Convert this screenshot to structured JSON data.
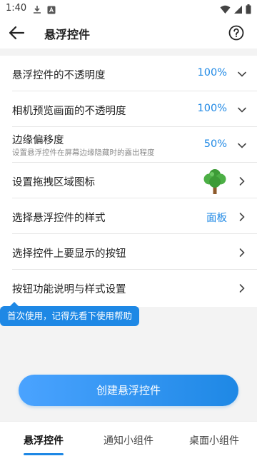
{
  "status_bar": {
    "time": "1:40",
    "left_icons": [
      "download-icon",
      "app-a-icon"
    ],
    "right_icons": [
      "wifi-icon",
      "signal-icon",
      "battery-icon"
    ]
  },
  "app_bar": {
    "title": "悬浮控件",
    "back_icon": "arrow-left-icon",
    "help_icon": "help-circle-icon"
  },
  "settings": [
    {
      "label": "悬浮控件的不透明度",
      "value": "100%",
      "control": "chevron-down-icon"
    },
    {
      "label": "相机预览画面的不透明度",
      "value": "100%",
      "control": "chevron-down-icon"
    },
    {
      "label": "边缘偏移度",
      "sublabel": "设置悬浮控件在屏幕边缘隐藏时的露出程度",
      "value": "50%",
      "control": "chevron-down-icon"
    },
    {
      "label": "设置拖拽区域图标",
      "icon": "tree-icon",
      "control": "chevron-right-icon"
    },
    {
      "label": "选择悬浮控件的样式",
      "value": "面板",
      "control": "chevron-right-icon"
    },
    {
      "label": "选择控件上要显示的按钮",
      "control": "chevron-right-icon"
    },
    {
      "label": "按钮功能说明与样式设置",
      "control": "chevron-right-icon"
    }
  ],
  "tooltip": "首次使用，记得先看下使用帮助",
  "create_button": "创建悬浮控件",
  "tabs": [
    {
      "label": "悬浮控件",
      "active": true
    },
    {
      "label": "通知小组件",
      "active": false
    },
    {
      "label": "桌面小组件",
      "active": false
    }
  ],
  "colors": {
    "accent": "#1e88e5",
    "background": "#f3f3f3"
  }
}
